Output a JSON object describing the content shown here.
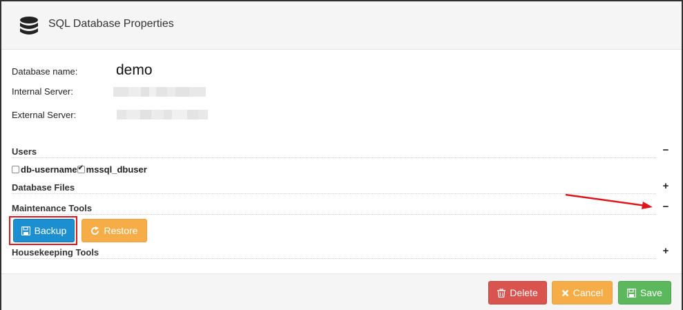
{
  "header": {
    "title": "SQL Database Properties",
    "icon": "database-icon"
  },
  "fields": {
    "database_name_label": "Database name:",
    "database_name_value": "demo",
    "internal_server_label": "Internal Server:",
    "external_server_label": "External Server:"
  },
  "sections": {
    "users": {
      "title": "Users",
      "toggle": "−"
    },
    "database_files": {
      "title": "Database Files",
      "toggle": "+"
    },
    "maintenance_tools": {
      "title": "Maintenance Tools",
      "toggle": "−"
    },
    "housekeeping_tools": {
      "title": "Housekeeping Tools",
      "toggle": "+"
    }
  },
  "users": [
    {
      "name": "db-username",
      "checked": false
    },
    {
      "name": "mssql_dbuser",
      "checked": true
    }
  ],
  "maintenance": {
    "backup_label": "Backup",
    "restore_label": "Restore"
  },
  "footer": {
    "delete_label": "Delete",
    "cancel_label": "Cancel",
    "save_label": "Save"
  },
  "colors": {
    "backup": "#1b8fd0",
    "warning": "#f6ad47",
    "danger": "#d9534f",
    "success": "#5cb85c",
    "highlight": "#e0141b"
  }
}
